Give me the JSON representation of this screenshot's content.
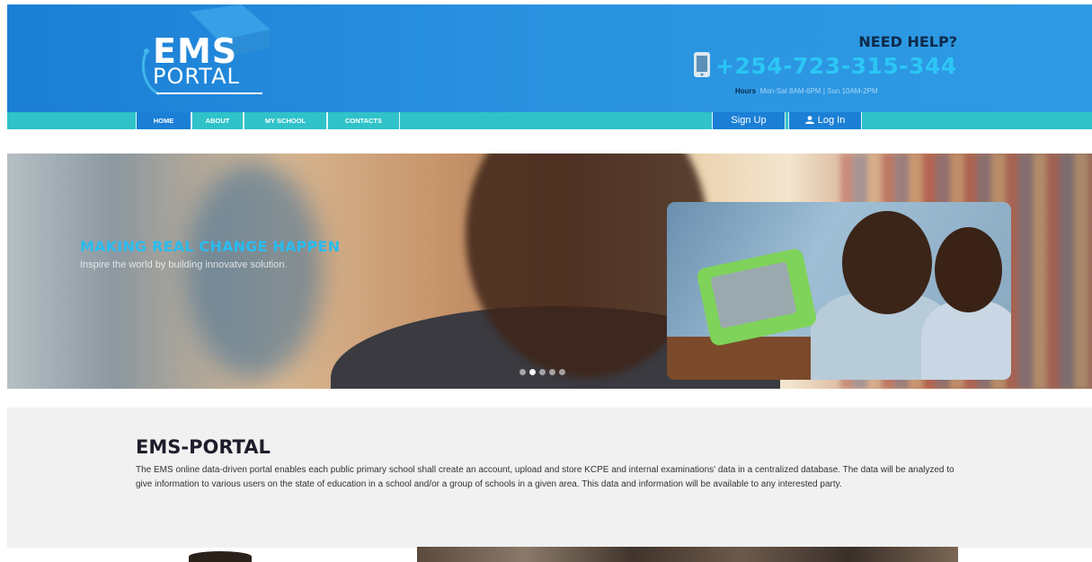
{
  "header": {
    "logo_line1": "EMS",
    "logo_line2": "PORTAL",
    "need_help": "NEED HELP?",
    "phone": "+254-723-315-344",
    "hours_label": "Hours",
    "hours_value": ": Mon-Sat 8AM-6PM | Sun 10AM-2PM"
  },
  "nav": {
    "items": [
      {
        "label": "HOME",
        "active": true
      },
      {
        "label": "ABOUT",
        "active": false
      },
      {
        "label": "MY SCHOOL",
        "active": false
      },
      {
        "label": "CONTACTS",
        "active": false
      }
    ],
    "sign_up": "Sign Up",
    "log_in": "Log In"
  },
  "hero": {
    "title": "MAKING REAL CHANGE HAPPEN",
    "subtitle": "Inspire the world by building innovatve solution.",
    "slide_count": 5,
    "active_slide": 2
  },
  "about": {
    "title": "EMS-PORTAL",
    "body": "The EMS online data-driven portal enables each public primary school shall create an account, upload and store KCPE and internal examinations' data in a centralized database. The data will be analyzed to give information to various users on the state of education in a school and/or a group of schools in a given area. This data and information will be available to any interested party."
  },
  "colors": {
    "header_blue": "#1b7fd6",
    "nav_teal": "#30c2c9",
    "phone_cyan": "#2bc6f5",
    "hero_title_cyan": "#29bcf0"
  }
}
